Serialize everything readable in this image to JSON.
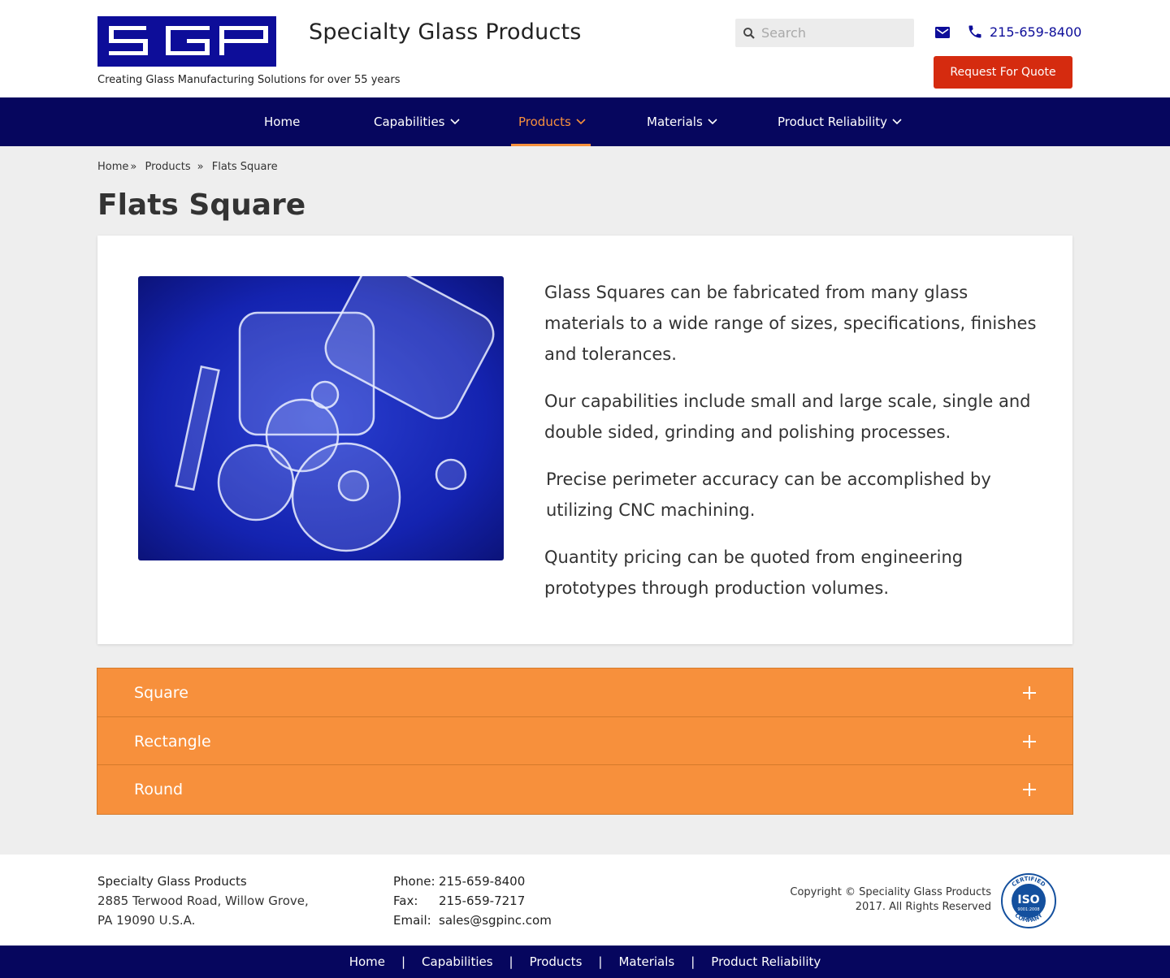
{
  "header": {
    "logo_text": "SGP",
    "site_title": "Specialty Glass Products",
    "tagline": "Creating Glass Manufacturing Solutions for over 55 years",
    "search_placeholder": "Search",
    "phone": "215-659-8400",
    "quote_button": "Request For Quote",
    "brand_color": "#0d0d99",
    "quote_color": "#d52b0f"
  },
  "nav": {
    "items": [
      {
        "label": "Home",
        "dropdown": false
      },
      {
        "label": "Capabilities",
        "dropdown": true
      },
      {
        "label": "Products",
        "dropdown": true,
        "active": true
      },
      {
        "label": "Materials",
        "dropdown": true
      },
      {
        "label": "Product Reliability",
        "dropdown": true
      }
    ],
    "background": "#06065e",
    "active_color": "#f7903c"
  },
  "breadcrumb": {
    "items": [
      "Home",
      "Products",
      "Flats Square"
    ],
    "separator": "»"
  },
  "page": {
    "title": "Flats Square",
    "paragraphs": [
      "Glass Squares can be fabricated from many glass materials to a wide range of sizes, specifications, finishes and tolerances.",
      "Our capabilities include small and large scale, single and double sided, grinding and polishing processes.",
      "Precise perimeter accuracy can be accomplished by utilizing CNC machining.",
      "Quantity pricing can be quoted from engineering prototypes through production volumes."
    ]
  },
  "accordion": {
    "items": [
      "Square",
      "Rectangle",
      "Round"
    ],
    "color": "#f7903c"
  },
  "footer": {
    "company": "Specialty Glass Products",
    "address_line1": "2885 Terwood Road, Willow Grove,",
    "address_line2": "PA 19090 U.S.A.",
    "phone_label": "Phone:",
    "phone": "215-659-8400",
    "fax_label": "Fax:",
    "fax": "215-659-7217",
    "email_label": "Email:",
    "email": "sales@sgpinc.com",
    "copyright": "Copyright © Speciality Glass Products 2017. All Rights Reserved",
    "badge": {
      "top": "CERTIFIED",
      "center": "ISO",
      "number": "9001:2008",
      "bottom": "COMPANY"
    }
  },
  "bottom_nav": [
    "Home",
    "Capabilities",
    "Products",
    "Materials",
    "Product Reliability"
  ],
  "icons": {
    "search": "search-icon",
    "mail": "mail-icon",
    "phone": "phone-icon",
    "chevron": "chevron-down-icon",
    "plus": "plus-icon"
  }
}
